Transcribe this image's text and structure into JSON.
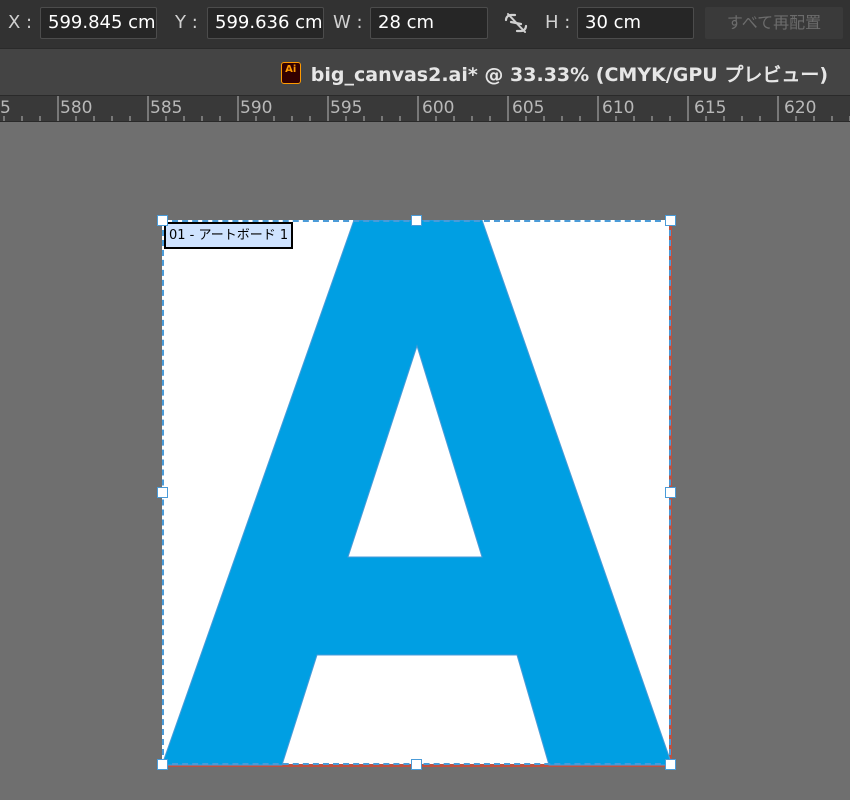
{
  "control_bar": {
    "x_label": "X :",
    "x_value": "599.845 cm",
    "y_label": "Y :",
    "y_value": "599.636 cm",
    "w_label": "W :",
    "w_value": "28 cm",
    "h_label": "H :",
    "h_value": "30 cm",
    "link_icon": "unlink-icon",
    "arrange_label": "すべて再配置"
  },
  "document_tab": {
    "icon": "Ai",
    "title": "big_canvas2.ai* @ 33.33% (CMYK/GPU プレビュー)"
  },
  "ruler": {
    "labels": [
      "5",
      "580",
      "585",
      "590",
      "595",
      "600",
      "605",
      "610",
      "615",
      "620"
    ]
  },
  "artboard": {
    "label": "01 - アートボード 1",
    "letter": "A",
    "letter_color": "#009fe3"
  },
  "colors": {
    "accent": "#4a9bd8",
    "artboard_border": "#c0503f"
  }
}
